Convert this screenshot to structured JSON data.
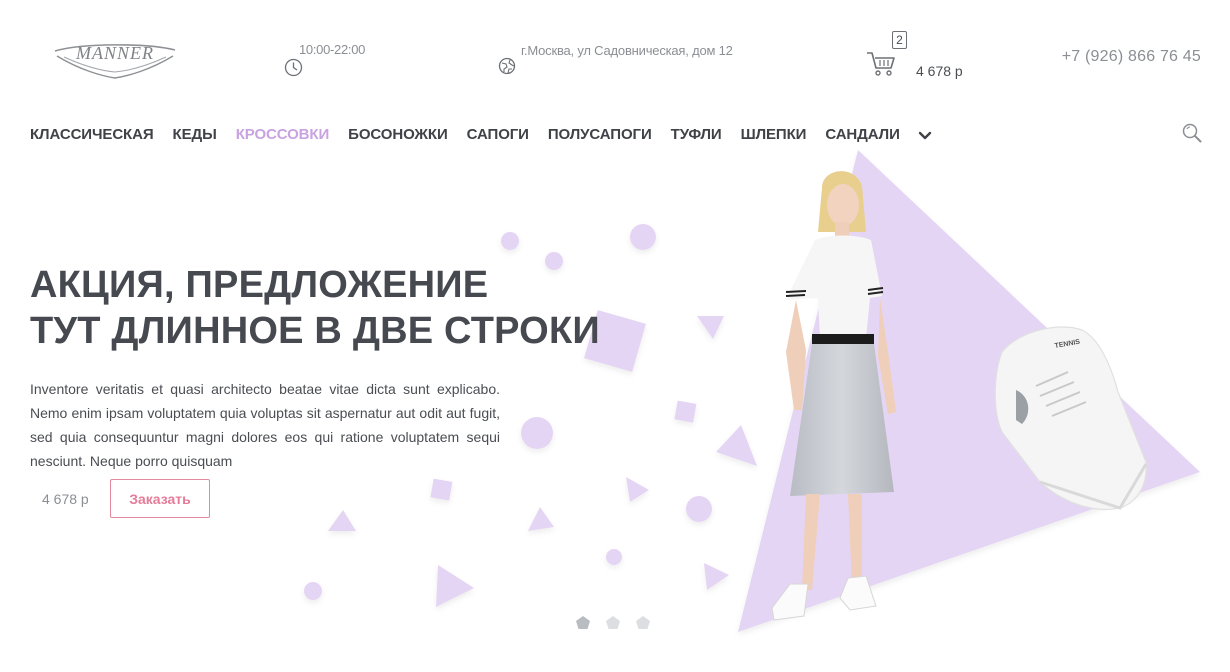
{
  "header": {
    "logo_text": "MANNER",
    "hours": "10:00-22:00",
    "address": "г.Москва, ул Садовническая, дом 12",
    "cart": {
      "count": "2",
      "total": "4 678 р"
    },
    "phone": "+7 (926) 866 76 45"
  },
  "nav": {
    "items": [
      {
        "label": "КЛАССИЧЕСКАЯ",
        "active": false
      },
      {
        "label": "КЕДЫ",
        "active": false
      },
      {
        "label": "КРОССОВКИ",
        "active": true
      },
      {
        "label": "БОСОНОЖКИ",
        "active": false
      },
      {
        "label": "САПОГИ",
        "active": false
      },
      {
        "label": "ПОЛУСАПОГИ",
        "active": false
      },
      {
        "label": "ТУФЛИ",
        "active": false
      },
      {
        "label": "ШЛЕПКИ",
        "active": false
      },
      {
        "label": "САНДАЛИ",
        "active": false
      }
    ],
    "more_icon": "chevron-down-icon",
    "search_icon": "search-icon"
  },
  "hero": {
    "title_line1": "АКЦИЯ, ПРЕДЛОЖЕНИЕ",
    "title_line2": "ТУТ ДЛИННОЕ В ДВЕ СТРОКИ",
    "description": "Inventore veritatis et quasi architecto beatae vitae dicta sunt explicabo. Nemo enim ipsam voluptatem quia voluptas sit aspernatur aut odit aut fugit, sed quia consequuntur magni dolores eos qui ratione voluptatem sequi nesciunt. Neque porro quisquam",
    "price": "4 678 р",
    "order_label": "Заказать",
    "slides_total": 3,
    "active_slide": 1,
    "sneaker_brand": "TENNIS"
  },
  "colors": {
    "accent": "#c9a2e2",
    "shape": "#e5d5f4",
    "button": "#e57b98",
    "text_dark": "#3f4247",
    "text_muted": "#8b8e93",
    "dot": "#c5c7cb"
  }
}
